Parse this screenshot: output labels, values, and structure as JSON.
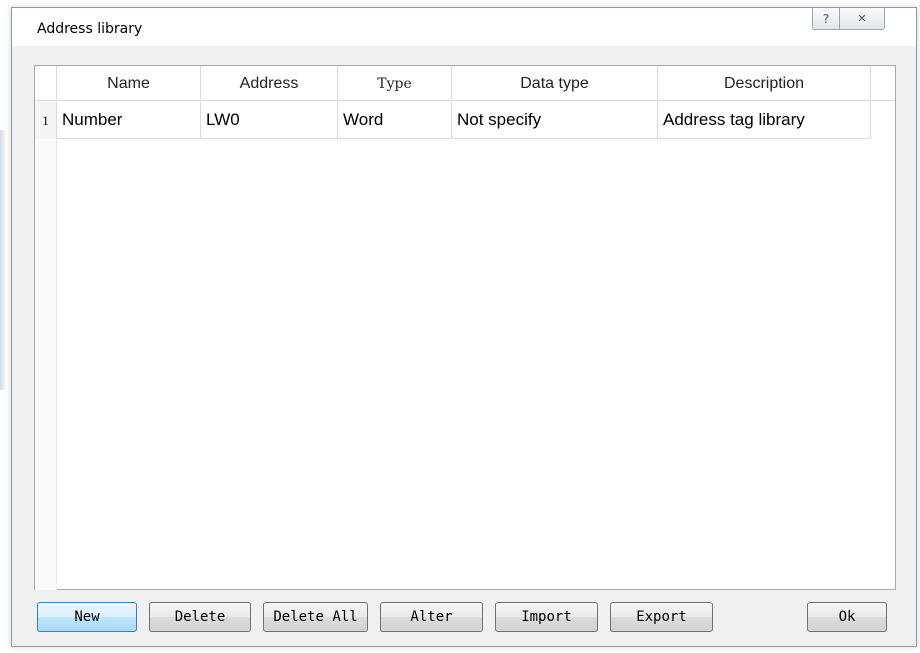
{
  "dialog": {
    "title": "Address library",
    "help_glyph": "?",
    "close_glyph": "✕"
  },
  "grid": {
    "columns": [
      "Name",
      "Address",
      "Type",
      "Data type",
      "Description"
    ],
    "rows": [
      {
        "index": "1",
        "cells": [
          "Number",
          "LW0",
          "Word",
          "Not specify",
          "Address tag library"
        ]
      }
    ]
  },
  "buttons": {
    "new": "New",
    "delete": "Delete",
    "delete_all": "Delete All",
    "alter": "Alter",
    "import": "Import",
    "export": "Export",
    "ok": "Ok"
  },
  "icons": {
    "help": "question-mark-icon",
    "close": "close-icon"
  }
}
